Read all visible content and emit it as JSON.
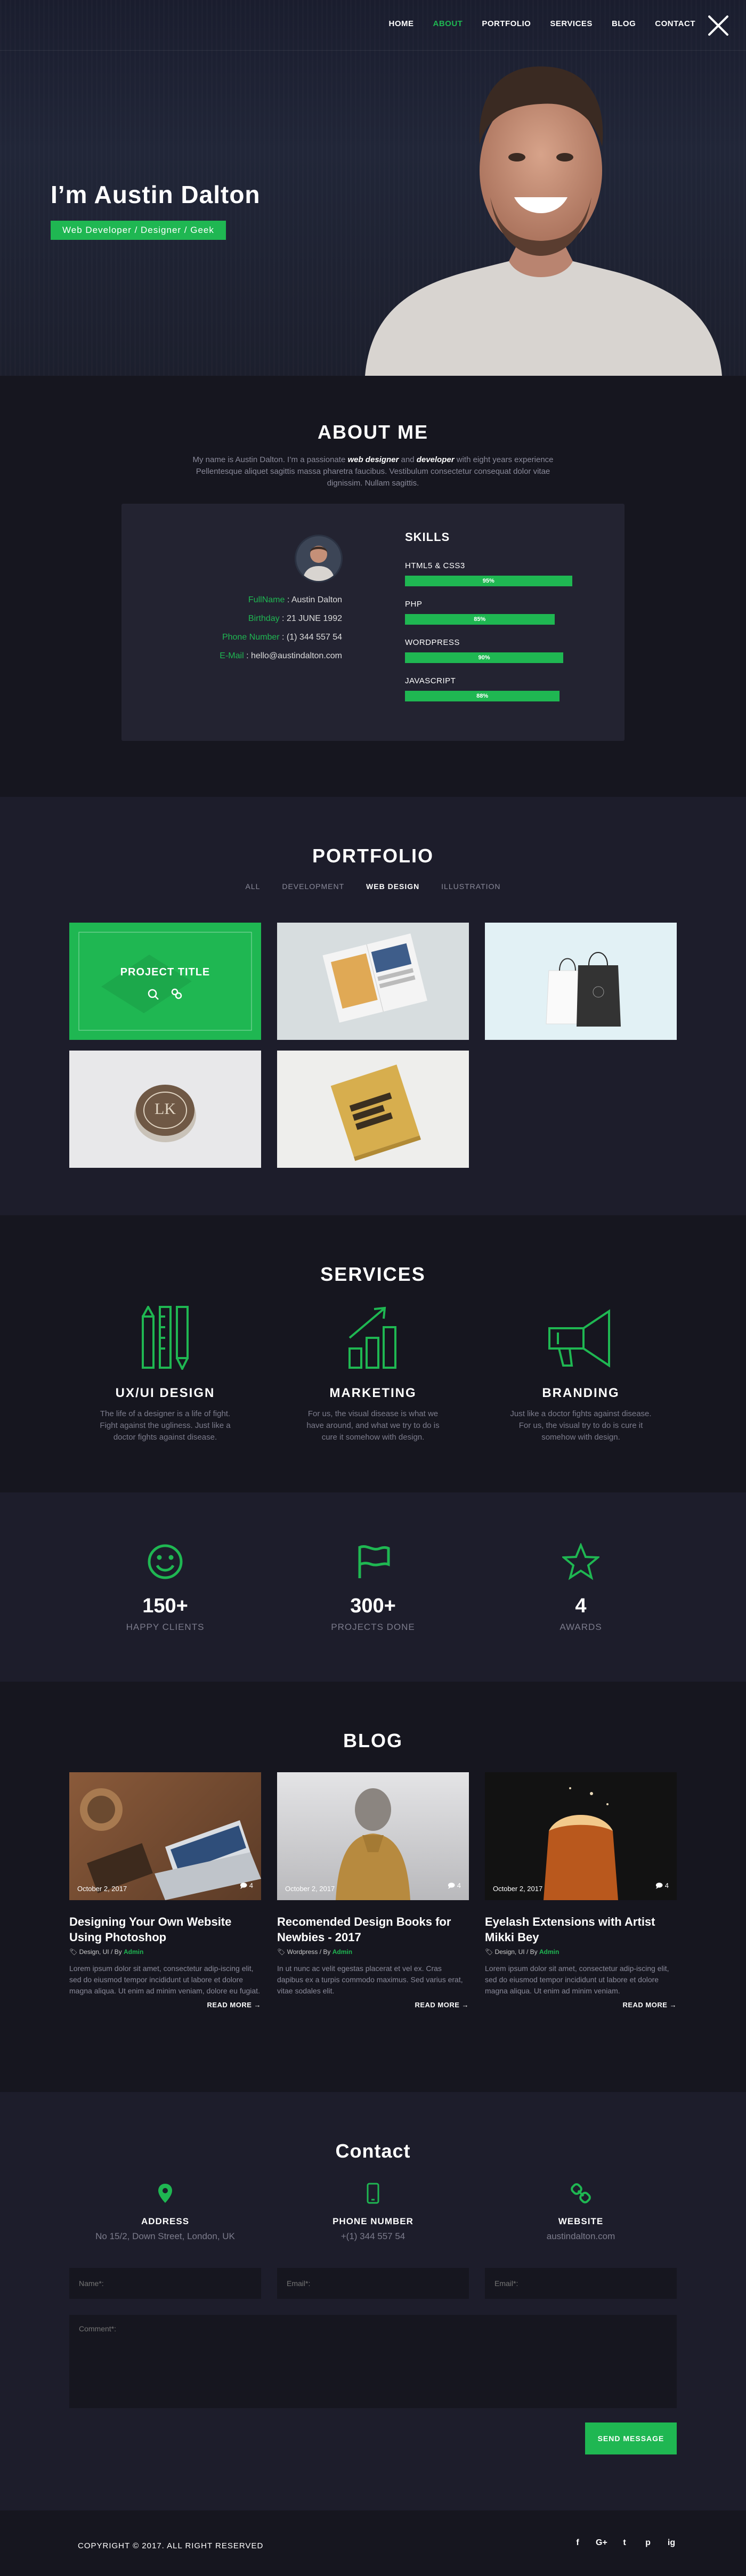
{
  "nav": {
    "items": [
      "HOME",
      "ABOUT",
      "PORTFOLIO",
      "SERVICES",
      "BLOG",
      "CONTACT"
    ],
    "active": "ABOUT"
  },
  "hero": {
    "title": "I’m Austin Dalton",
    "subtitle": "Web Developer / Designer / Geek"
  },
  "about": {
    "title": "ABOUT ME",
    "intro_before": "My name is Austin Dalton. I’m a passionate ",
    "intro_em1": "web designer",
    "intro_mid": " and ",
    "intro_em2": "developer",
    "intro_after": " with eight years experience Pellentesque aliquet sagittis massa pharetra faucibus. Vestibulum consectetur consequat dolor vitae dignissim. Nullam sagittis.",
    "info": [
      {
        "key": "FullName",
        "value": "Austin Dalton"
      },
      {
        "key": "Birthday",
        "value": "21 JUNE 1992"
      },
      {
        "key": "Phone Number",
        "value": "(1) 344 557 54"
      },
      {
        "key": "E-Mail",
        "value": "hello@austindalton.com"
      }
    ],
    "skills_title": "SKILLS",
    "skills": [
      {
        "name": "HTML5 & CSS3",
        "pct": 95,
        "label": "95%"
      },
      {
        "name": "PHP",
        "pct": 85,
        "label": "85%"
      },
      {
        "name": "WORDPRESS",
        "pct": 90,
        "label": "90%"
      },
      {
        "name": "JAVASCRIPT",
        "pct": 88,
        "label": "88%"
      }
    ]
  },
  "portfolio": {
    "title": "PORTFOLIO",
    "filters": [
      "ALL",
      "DEVELOPMENT",
      "WEB DESIGN",
      "ILLUSTRATION"
    ],
    "active_filter": "WEB DESIGN",
    "hover_title": "PROJECT TITLE",
    "badge_text": "LK"
  },
  "services": {
    "title": "SERVICES",
    "items": [
      {
        "name": "UX/UI DESIGN",
        "icon": "design-tools-icon",
        "text": "The life of a designer is a life of fight. Fight against the ugliness. Just like a doctor fights against disease."
      },
      {
        "name": "MARKETING",
        "icon": "growth-chart-icon",
        "text": "For us, the visual disease is what we have around, and what we try to do is cure it somehow with design."
      },
      {
        "name": "BRANDING",
        "icon": "megaphone-icon",
        "text": "Just like a doctor fights against disease. For us, the visual try to do is cure it somehow with design."
      }
    ]
  },
  "stats": [
    {
      "num": "150+",
      "label": "HAPPY CLIENTS",
      "icon": "smiley-icon"
    },
    {
      "num": "300+",
      "label": "PROJECTS DONE",
      "icon": "flag-icon"
    },
    {
      "num": "4",
      "label": "AWARDS",
      "icon": "star-icon"
    }
  ],
  "blog": {
    "title": "BLOG",
    "posts": [
      {
        "date": "October 2, 2017",
        "comments": "4",
        "title": "Designing Your Own Website Using Photoshop",
        "cats": "Design, UI",
        "author": "Admin",
        "excerpt": "Lorem ipsum dolor sit amet, consectetur adip-iscing elit, sed do eiusmod tempor incididunt ut labore et dolore magna aliqua. Ut enim ad minim veniam,  dolore eu fugiat.",
        "more": "READ MORE →"
      },
      {
        "date": "October 2, 2017",
        "comments": "4",
        "title": "Recomended  Design Books for Newbies - 2017",
        "cats": "Wordpress",
        "author": "Admin",
        "excerpt": "In ut nunc ac velit egestas placerat et vel ex. Cras dapibus ex a turpis commodo maximus. Sed varius erat, vitae sodales elit.",
        "more": "READ MORE →"
      },
      {
        "date": "October 2, 2017",
        "comments": "4",
        "title": "Eyelash Extensions with Artist Mikki Bey",
        "cats": "Design, UI",
        "author": "Admin",
        "excerpt": "Lorem ipsum dolor sit amet, consectetur adip-iscing elit, sed do eiusmod tempor incididunt ut labore et dolore magna aliqua. Ut enim ad minim veniam.",
        "more": "READ MORE →"
      }
    ]
  },
  "contact": {
    "title": "Contact",
    "items": [
      {
        "label": "ADDRESS",
        "value": "No 15/2, Down Street, London, UK",
        "icon": "map-pin-icon"
      },
      {
        "label": "PHONE NUMBER",
        "value": "+(1) 344 557 54",
        "icon": "phone-icon"
      },
      {
        "label": "WEBSITE",
        "value": "austindalton.com",
        "icon": "link-icon"
      }
    ],
    "placeholders": {
      "name": "Name*:",
      "email1": "Email*:",
      "email2": "Email*:",
      "comment": "Comment*:"
    },
    "send": "SEND MESSAGE"
  },
  "footer": {
    "copyright": "COPYRIGHT © 2017. ALL RIGHT RESERVED",
    "social": [
      "f",
      "G+",
      "t",
      "p",
      "ig"
    ]
  },
  "colors": {
    "accent": "#1fb752",
    "dark": "#16161f",
    "panel": "#1d1d2b"
  }
}
